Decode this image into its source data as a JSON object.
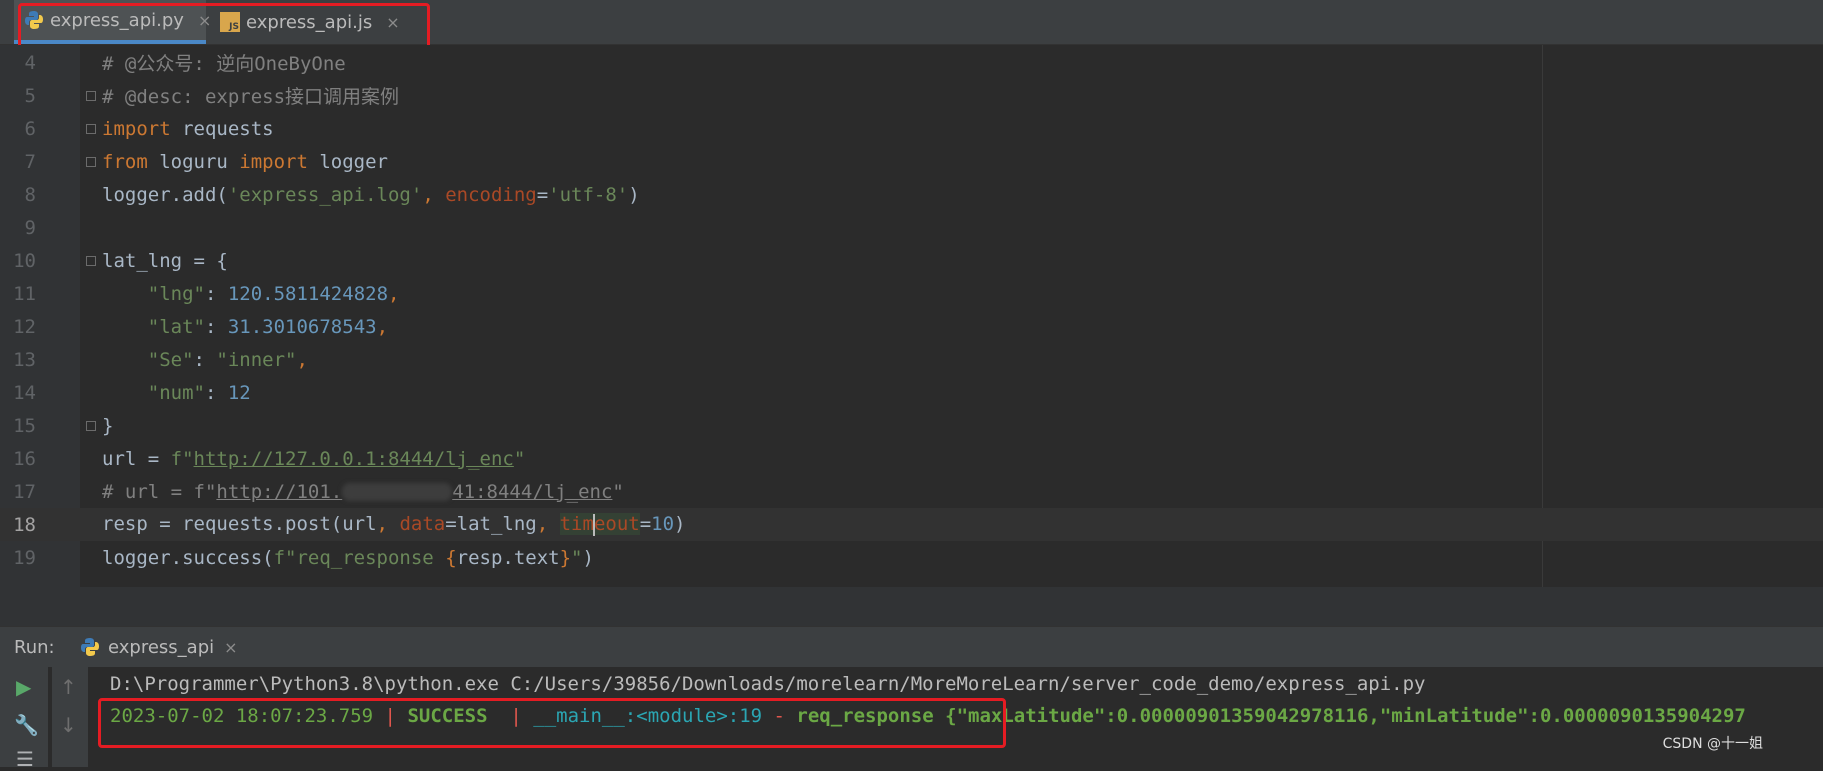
{
  "tabs": [
    {
      "label": "express_api.py",
      "close": "×",
      "icon": "python-file-icon",
      "active": true
    },
    {
      "label": "express_api.js",
      "close": "×",
      "icon": "js-file-icon",
      "active": false
    }
  ],
  "editor": {
    "lines": [
      {
        "n": "4"
      },
      {
        "n": "5"
      },
      {
        "n": "6"
      },
      {
        "n": "7"
      },
      {
        "n": "8"
      },
      {
        "n": "9"
      },
      {
        "n": "10"
      },
      {
        "n": "11"
      },
      {
        "n": "12"
      },
      {
        "n": "13"
      },
      {
        "n": "14"
      },
      {
        "n": "15"
      },
      {
        "n": "16"
      },
      {
        "n": "17"
      },
      {
        "n": "18"
      },
      {
        "n": "19"
      }
    ],
    "code": {
      "l4": "# @公众号: 逆向OneByOne",
      "l5": "# @desc: express接口调用案例",
      "import_kw": "import",
      "l6_rest": " requests",
      "from_kw": "from",
      "l7_mid": " loguru ",
      "l7_rest": " logger",
      "l8_a": "logger.add(",
      "l8_str": "'express_api.log'",
      "l8_comma": ", ",
      "l8_param": "encoding",
      "l8_eq": "=",
      "l8_str2": "'utf-8'",
      "l8_end": ")",
      "l10": "lat_lng = {",
      "l11_key": "\"lng\"",
      "l11_num": "120.5811424828",
      "l12_key": "\"lat\"",
      "l12_num": "31.3010678543",
      "l13_key": "\"Se\"",
      "l13_val": "\"inner\"",
      "l14_key": "\"num\"",
      "l14_num": "12",
      "l15": "}",
      "l16_a": "url = ",
      "l16_f": "f\"",
      "l16_url": "http://127.0.0.1:8444/lj_enc",
      "l16_q": "\"",
      "l17_a": "# url = f\"",
      "l17_url1": "http://101.",
      "l17_url2": "41:8444/lj_enc",
      "l17_q": "\"",
      "l18_a": "resp = requests.post(url",
      "l18_p1": "data",
      "l18_b": "=lat_lng",
      "l18_p2a": "tim",
      "l18_p2b": "eout",
      "l18_c": "=",
      "l18_num": "10",
      "l18_end": ")",
      "l19_a": "logger.success(",
      "l19_str": "f\"req_response ",
      "l19_brace_open": "{",
      "l19_expr": "resp.text",
      "l19_brace_close": "}",
      "l19_str2": "\"",
      "l19_end": ")"
    }
  },
  "run": {
    "label": "Run:",
    "tab_label": "express_api",
    "tab_close": "×"
  },
  "console": {
    "cmd": "D:\\Programmer\\Python3.8\\python.exe C:/Users/39856/Downloads/morelearn/MoreMoreLearn/server_code_demo/express_api.py",
    "timestamp": "2023-07-02 18:07:23.759",
    "sep1": " | ",
    "level": "SUCCESS ",
    "sep2": " | ",
    "module": "__main__",
    "colon1": ":",
    "func": "<module>",
    "lineno": ":19",
    "dash": " - ",
    "msg": "req_response {\"maxLatitude\":0.0000090135904297811‌6,\"minLatitude\":0.0000090135904297"
  },
  "watermark": "CSDN @十一姐",
  "colors": {
    "accent": "#4a88c7",
    "highlight": "#e51c23",
    "success": "#6ba845"
  }
}
